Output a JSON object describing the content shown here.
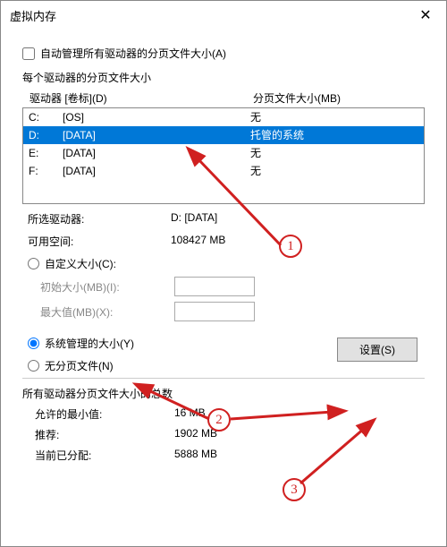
{
  "window": {
    "title": "虚拟内存",
    "close_glyph": "✕"
  },
  "auto_manage": {
    "checked": false,
    "label": "自动管理所有驱动器的分页文件大小(A)"
  },
  "section_label": "每个驱动器的分页文件大小",
  "headers": {
    "drive": "驱动器 [卷标](D)",
    "size": "分页文件大小(MB)"
  },
  "drives": [
    {
      "letter": "C:",
      "label": "[OS]",
      "size": "无",
      "selected": false
    },
    {
      "letter": "D:",
      "label": "[DATA]",
      "size": "托管的系统",
      "selected": true
    },
    {
      "letter": "E:",
      "label": "[DATA]",
      "size": "无",
      "selected": false
    },
    {
      "letter": "F:",
      "label": "[DATA]",
      "size": "无",
      "selected": false
    }
  ],
  "info": {
    "selected_drive_label": "所选驱动器:",
    "selected_drive_value": "D:  [DATA]",
    "free_space_label": "可用空间:",
    "free_space_value": "108427 MB"
  },
  "options": {
    "custom": {
      "label": "自定义大小(C):",
      "checked": false,
      "initial_label": "初始大小(MB)(I):",
      "initial_value": "",
      "max_label": "最大值(MB)(X):",
      "max_value": ""
    },
    "system_managed": {
      "label": "系统管理的大小(Y)",
      "checked": true
    },
    "none": {
      "label": "无分页文件(N)",
      "checked": false
    },
    "set_button": "设置(S)"
  },
  "totals_label": "所有驱动器分页文件大小的总数",
  "totals": {
    "min_label": "允许的最小值:",
    "min_value": "16 MB",
    "rec_label": "推荐:",
    "rec_value": "1902 MB",
    "cur_label": "当前已分配:",
    "cur_value": "5888 MB"
  },
  "markers": {
    "m1": "1",
    "m2": "2",
    "m3": "3"
  }
}
